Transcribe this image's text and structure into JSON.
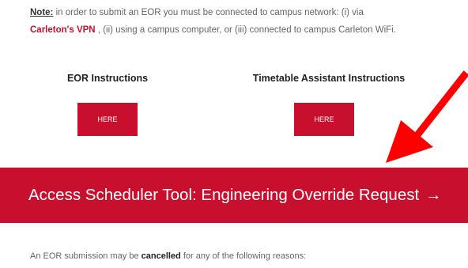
{
  "note": {
    "label": "Note:",
    "text_before_link": " in order to submit an EOR you must be connected to campus network: (i) via",
    "link_text": "Carleton's VPN",
    "text_after_link": " , (ii) using a campus computer, or (iii) connected to campus Carleton WiFi."
  },
  "instructions": [
    {
      "title": "EOR Instructions",
      "button": "HERE"
    },
    {
      "title": "Timetable Assistant Instructions",
      "button": "HERE"
    }
  ],
  "access": {
    "label": "Access Scheduler Tool: Engineering Override Request",
    "arrow": "→"
  },
  "cancel": {
    "before": "An EOR submission may be ",
    "bold": "cancelled",
    "after": " for any of the following reasons:"
  },
  "colors": {
    "accent": "#c8102e",
    "annotation_arrow": "#ff0000"
  },
  "icons": {
    "annotation": "red-arrow-icon"
  }
}
